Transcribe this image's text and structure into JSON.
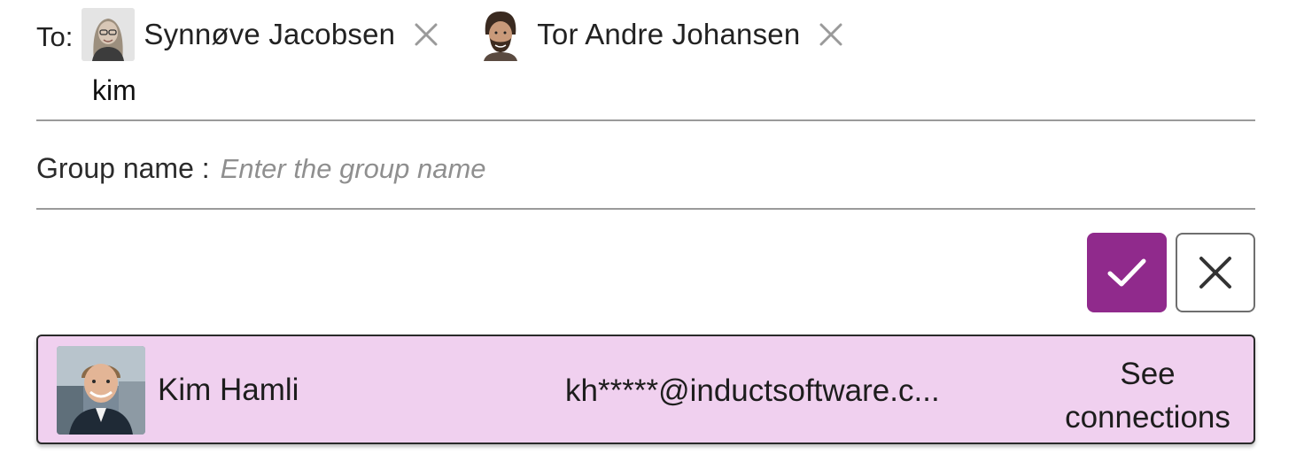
{
  "recipients": {
    "label": "To:",
    "chips": [
      {
        "name": "Synnøve Jacobsen",
        "avatar_icon": "person-photo-icon",
        "remove_icon": "close-icon"
      },
      {
        "name": "Tor Andre Johansen",
        "avatar_icon": "person-photo-icon",
        "remove_icon": "close-icon"
      }
    ],
    "typed_value": "kim"
  },
  "group": {
    "label": "Group name :",
    "placeholder": "Enter the group name",
    "value": ""
  },
  "actions": {
    "confirm_icon": "check-icon",
    "cancel_icon": "close-icon",
    "confirm_color": "#902a8c"
  },
  "suggestion": {
    "name": "Kim Hamli",
    "email": "kh*****@inductsoftware.c...",
    "connections_label_line1": "See",
    "connections_label_line2": "connections",
    "highlight_color": "#f0d0ef"
  }
}
